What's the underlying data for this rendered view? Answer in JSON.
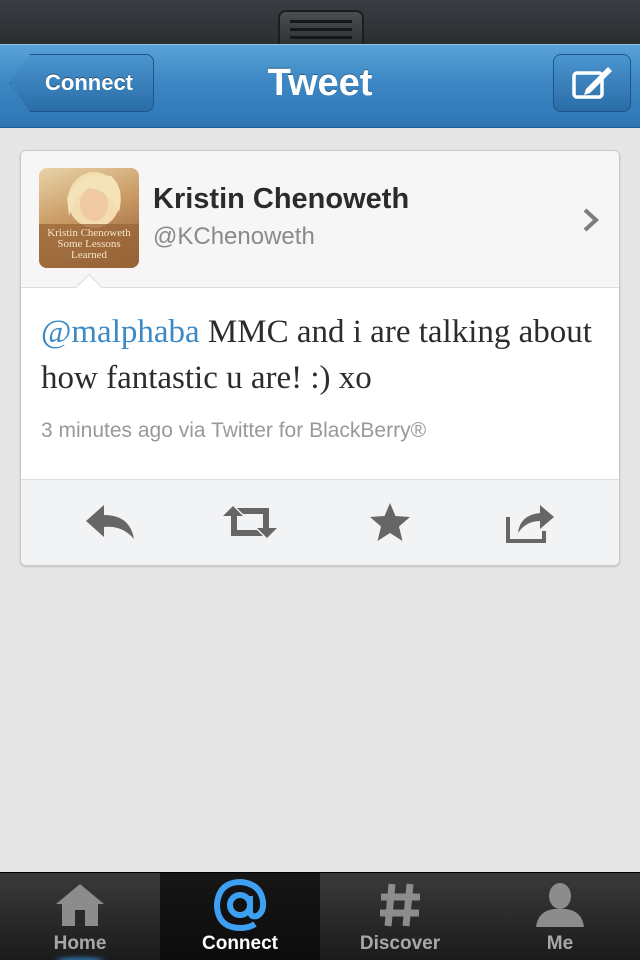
{
  "nav": {
    "back_label": "Connect",
    "title": "Tweet"
  },
  "tweet": {
    "name": "Kristin Chenoweth",
    "handle": "@KChenoweth",
    "avatar_caption": "Kristin Chenoweth Some Lessons Learned",
    "mention": "@malphaba",
    "text": " MMC and i are talking about how fantastic u are! :) xo",
    "meta": "3 minutes ago via Twitter for BlackBerry®"
  },
  "actions": {
    "icons": [
      "reply-icon",
      "retweet-icon",
      "favorite-icon",
      "share-icon"
    ]
  },
  "tabbar": {
    "tabs": [
      {
        "label": "Home",
        "icon": "home-icon"
      },
      {
        "label": "Connect",
        "icon": "at-icon",
        "active": true
      },
      {
        "label": "Discover",
        "icon": "hash-icon"
      },
      {
        "label": "Me",
        "icon": "person-icon"
      }
    ]
  },
  "colors": {
    "nav_blue": "#3c87c4",
    "mention_blue": "#3b8ac6",
    "tab_active_glow": "#3a9bf0"
  }
}
